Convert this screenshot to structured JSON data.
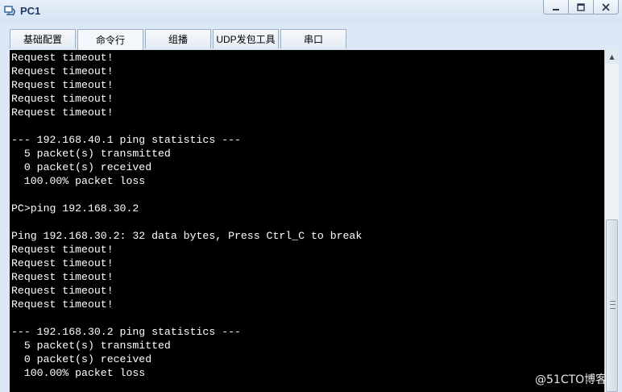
{
  "window": {
    "title": "PC1",
    "icon": "pc-app-icon",
    "controls": [
      "minimize-icon",
      "maximize-icon",
      "close-icon"
    ]
  },
  "tabs": [
    {
      "label": "基础配置",
      "active": false
    },
    {
      "label": "命令行",
      "active": true
    },
    {
      "label": "组播",
      "active": false
    },
    {
      "label": "UDP发包工具",
      "active": false
    },
    {
      "label": "串口",
      "active": false
    }
  ],
  "terminal": {
    "lines": [
      "Request timeout!",
      "Request timeout!",
      "Request timeout!",
      "Request timeout!",
      "Request timeout!",
      "",
      "--- 192.168.40.1 ping statistics ---",
      "  5 packet(s) transmitted",
      "  0 packet(s) received",
      "  100.00% packet loss",
      "",
      "PC>ping 192.168.30.2",
      "",
      "Ping 192.168.30.2: 32 data bytes, Press Ctrl_C to break",
      "Request timeout!",
      "Request timeout!",
      "Request timeout!",
      "Request timeout!",
      "Request timeout!",
      "",
      "--- 192.168.30.2 ping statistics ---",
      "  5 packet(s) transmitted",
      "  0 packet(s) received",
      "  100.00% packet loss"
    ]
  },
  "watermark": "@51CTO博客"
}
